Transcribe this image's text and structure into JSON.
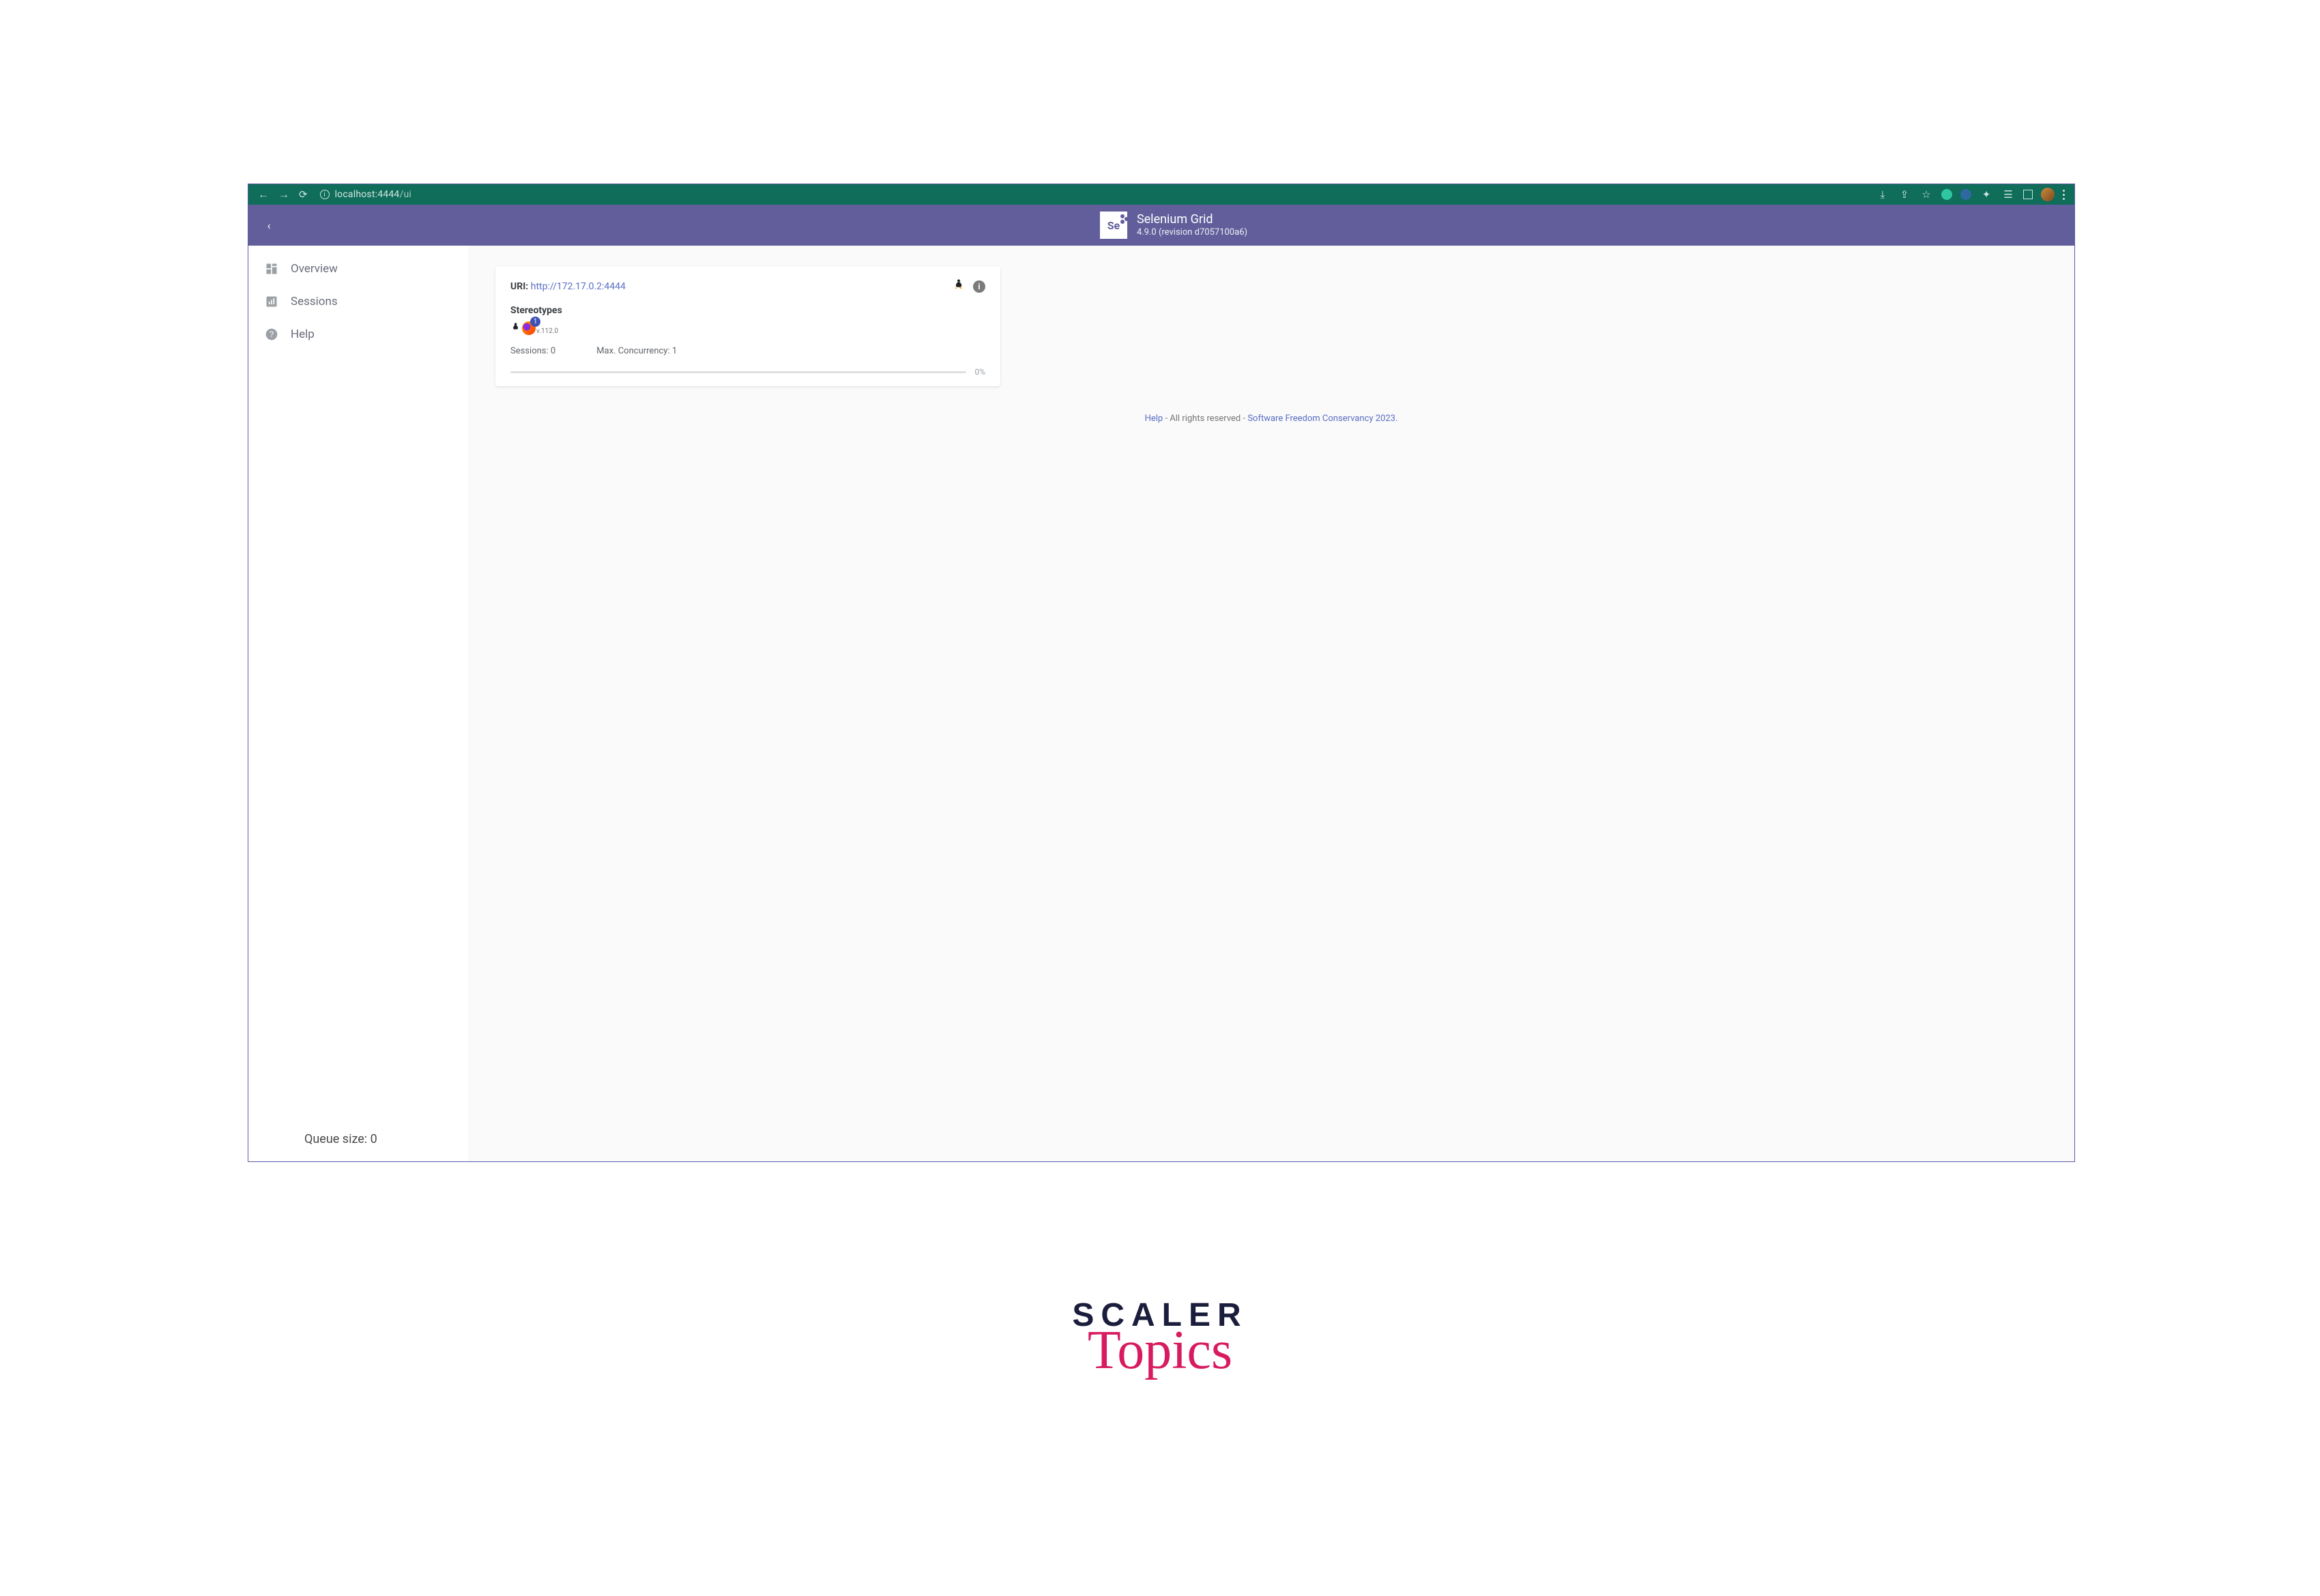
{
  "browser": {
    "url_host": "localhost:4444",
    "url_path": "/ui"
  },
  "header": {
    "logo_text": "Se",
    "title": "Selenium Grid",
    "version": "4.9.0 (revision d7057100a6)"
  },
  "sidebar": {
    "items": [
      {
        "label": "Overview"
      },
      {
        "label": "Sessions"
      },
      {
        "label": "Help"
      }
    ],
    "queue_label": "Queue size: 0"
  },
  "node_card": {
    "uri_label": "URI:",
    "uri_value": "http://172.17.0.2:4444",
    "stereotypes_label": "Stereotypes",
    "stereo_badge": "1",
    "stereo_version": "v.112.0",
    "sessions_label": "Sessions: 0",
    "concurrency_label": "Max. Concurrency: 1",
    "progress_pct": "0%"
  },
  "footer": {
    "help": "Help",
    "middle": " - All rights reserved - ",
    "tail": "Software Freedom Conservancy 2023."
  },
  "brand": {
    "word1": "SCALER",
    "word2": "Topics"
  }
}
